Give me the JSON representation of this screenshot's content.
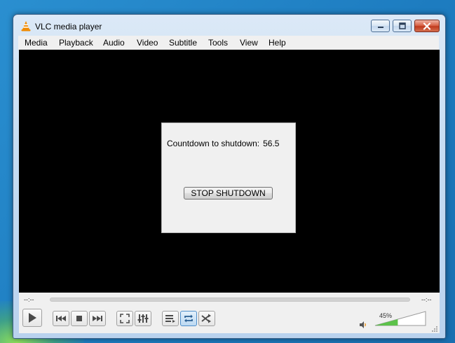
{
  "window": {
    "title": "VLC media player"
  },
  "menu": [
    {
      "label": "Media"
    },
    {
      "label": "Playback"
    },
    {
      "label": "Audio"
    },
    {
      "label": "Video"
    },
    {
      "label": "Subtitle"
    },
    {
      "label": "Tools"
    },
    {
      "label": "View"
    },
    {
      "label": "Help"
    }
  ],
  "dialog": {
    "countdown_label": "Countdown to shutdown:",
    "countdown_value": "56.5",
    "stop_button": "STOP SHUTDOWN"
  },
  "player": {
    "elapsed": "--:--",
    "remaining": "--:--",
    "volume_label": "45%",
    "volume_level": 0.45
  },
  "icons": {
    "app": "vlc-cone-icon",
    "play": "play-icon",
    "previous": "previous-icon",
    "stop": "stop-icon",
    "next": "next-icon",
    "fullscreen": "fullscreen-icon",
    "extended": "equalizer-icon",
    "playlist": "playlist-icon",
    "loop": "loop-icon",
    "random": "shuffle-icon",
    "volume": "speaker-icon"
  },
  "colors": {
    "accent": "#4f8fcb",
    "volume_fill": "#5cc24a",
    "vlc_orange": "#f08a00"
  }
}
